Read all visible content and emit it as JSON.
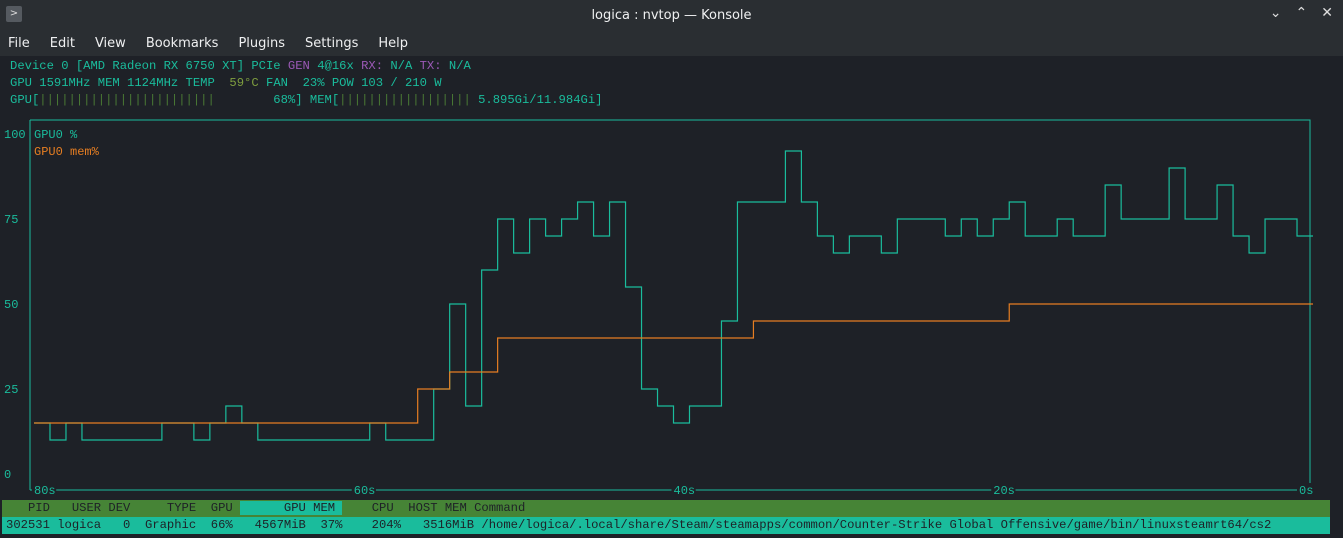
{
  "window": {
    "title": "logica : nvtop — Konsole"
  },
  "menu": [
    "File",
    "Edit",
    "View",
    "Bookmarks",
    "Plugins",
    "Settings",
    "Help"
  ],
  "device": {
    "line1_a": "Device 0 [AMD Radeon RX 6750 XT] PCIe ",
    "gen_label": "GEN",
    "gen_value": " 4@16x ",
    "rx_label": "RX:",
    "rx_value": " N/A ",
    "tx_label": "TX:",
    "tx_value": " N/A",
    "line2_a": "GPU 1591MHz MEM 1124MHz TEMP  ",
    "temp": "59°C",
    "line2_b": " FAN  23% POW 103 / 210 W",
    "gpu_bar_label": "GPU[",
    "gpu_bar_fill": "||||||||||||||||||||||||",
    "gpu_bar_value": "        68%]",
    "mem_bar_label": " MEM[",
    "mem_bar_fill": "||||||||||||||||||",
    "mem_bar_value": " 5.895Gi/11.984Gi]",
    "gpu_util_percent": 68,
    "mem_used_fraction": 0.492
  },
  "chart_data": {
    "type": "line",
    "y_ticks": [
      "100",
      "75",
      "50",
      "25",
      "0"
    ],
    "x_ticks": [
      "80s",
      "60s",
      "40s",
      "20s",
      "0s"
    ],
    "ylim": [
      0,
      100
    ],
    "xlim": [
      -80,
      0
    ],
    "series": [
      {
        "name": "GPU0 %",
        "color": "#1abc9c",
        "runs": [
          [
            15,
            1
          ],
          [
            10,
            1
          ],
          [
            15,
            1
          ],
          [
            10,
            5
          ],
          [
            15,
            2
          ],
          [
            10,
            1
          ],
          [
            15,
            1
          ],
          [
            20,
            1
          ],
          [
            15,
            1
          ],
          [
            10,
            7
          ],
          [
            15,
            1
          ],
          [
            10,
            3
          ],
          [
            25,
            1
          ],
          [
            50,
            1
          ],
          [
            20,
            1
          ],
          [
            60,
            1
          ],
          [
            75,
            1
          ],
          [
            65,
            1
          ],
          [
            75,
            1
          ],
          [
            70,
            1
          ],
          [
            75,
            1
          ],
          [
            80,
            1
          ],
          [
            70,
            1
          ],
          [
            80,
            1
          ],
          [
            55,
            1
          ],
          [
            25,
            1
          ],
          [
            20,
            1
          ],
          [
            15,
            1
          ],
          [
            20,
            2
          ],
          [
            45,
            1
          ],
          [
            80,
            3
          ],
          [
            95,
            1
          ],
          [
            80,
            1
          ],
          [
            70,
            1
          ],
          [
            65,
            1
          ],
          [
            70,
            2
          ],
          [
            65,
            1
          ],
          [
            75,
            3
          ],
          [
            70,
            1
          ],
          [
            75,
            1
          ],
          [
            70,
            1
          ],
          [
            75,
            1
          ],
          [
            80,
            1
          ],
          [
            70,
            2
          ],
          [
            75,
            1
          ],
          [
            70,
            2
          ],
          [
            85,
            1
          ],
          [
            75,
            3
          ],
          [
            90,
            1
          ],
          [
            75,
            2
          ],
          [
            85,
            1
          ],
          [
            70,
            1
          ],
          [
            65,
            1
          ],
          [
            75,
            2
          ],
          [
            70,
            1
          ]
        ]
      },
      {
        "name": "GPU0 mem%",
        "color": "#e67e22",
        "runs": [
          [
            15,
            24
          ],
          [
            25,
            2
          ],
          [
            30,
            3
          ],
          [
            40,
            16
          ],
          [
            45,
            16
          ],
          [
            50,
            19
          ]
        ]
      }
    ]
  },
  "processes": {
    "headers": {
      "a": "   PID   USER DEV     TYPE  GPU ",
      "sel": "      GPU MEM ",
      "b": "    CPU  HOST MEM Command"
    },
    "rows": [
      {
        "text": "302531 logica   0  Graphic  66%   4567MiB  37%    204%   3516MiB /home/logica/.local/share/Steam/steamapps/common/Counter-Strike Global Offensive/game/bin/linuxsteamrt64/cs2"
      }
    ]
  }
}
